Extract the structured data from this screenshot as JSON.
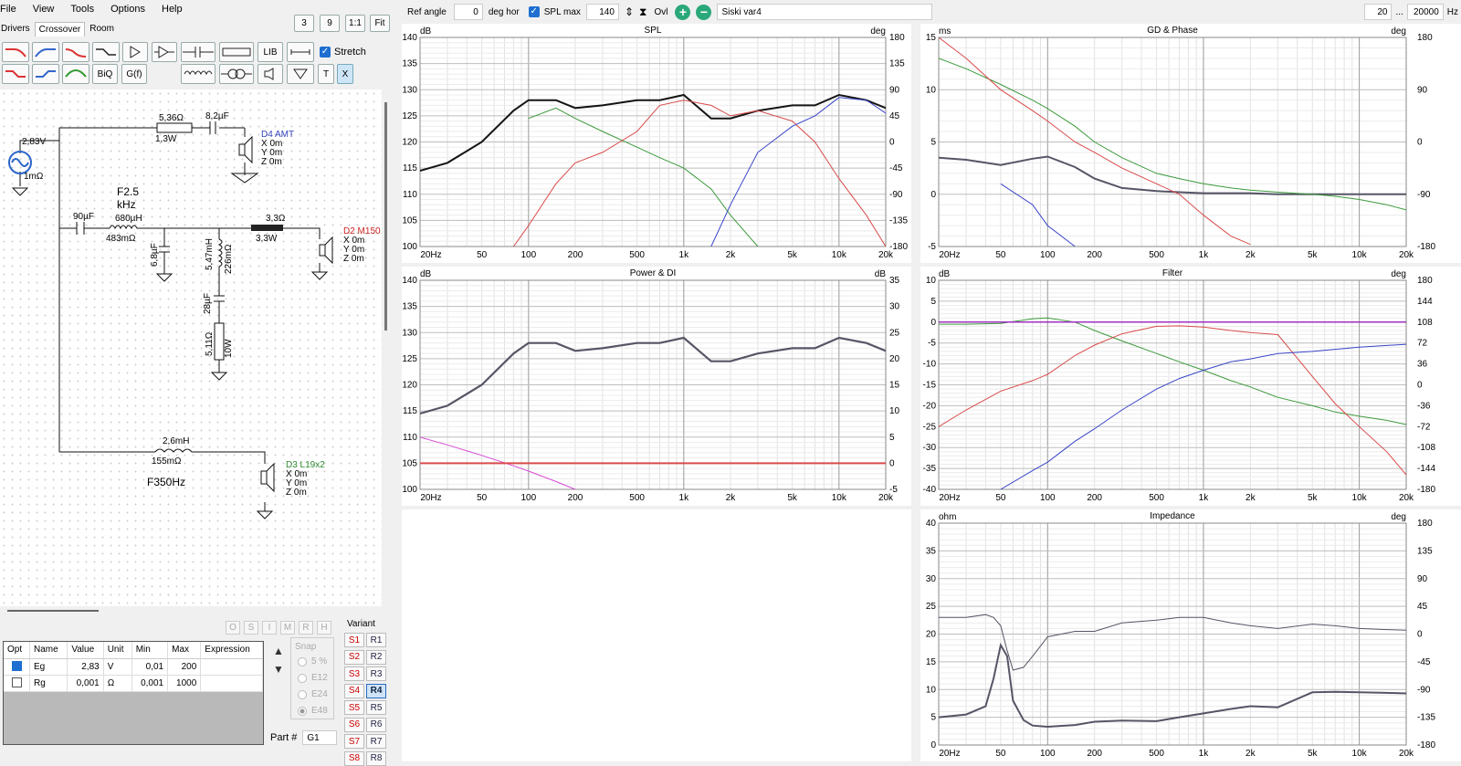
{
  "menu": [
    "File",
    "View",
    "Tools",
    "Options",
    "Help"
  ],
  "tabs": [
    "Drivers",
    "Crossover",
    "Room"
  ],
  "zoom_buttons": [
    "3",
    "9",
    "1:1",
    "Fit"
  ],
  "toolbar": {
    "lib": "LIB",
    "stretch": "Stretch",
    "biq": "BiQ",
    "gf": "G(f)",
    "t": "T",
    "x": "X"
  },
  "top": {
    "ref_angle_label": "Ref angle",
    "ref_angle_value": "0",
    "deg_hor": "deg hor",
    "spl_max_label": "SPL max",
    "spl_max_value": "140",
    "ovl": "Ovl",
    "project_name": "Siski var4",
    "f_min": "20",
    "dots": "...",
    "f_max": "20000",
    "hz": "Hz"
  },
  "schematic": {
    "source_voltage": "2,83V",
    "source_r": "1mΩ",
    "r1": "5,36Ω",
    "r1w": "1,3W",
    "c1": "8,2µF",
    "d4": {
      "name": "D4 AMT",
      "x": "X 0m",
      "y": "Y 0m",
      "z": "Z 0m"
    },
    "f25a": "F2.5",
    "f25b": "kHz",
    "c2": "90µF",
    "l1": "680µH",
    "l1r": "483mΩ",
    "r2": "3,3Ω",
    "r2w": "3,3W",
    "c3": "6,8µF",
    "l2": "5,47mH",
    "l2r": "226mΩ",
    "c4": "28µF",
    "r3": "5,11Ω",
    "r3w": "10W",
    "d2": {
      "name": "D2 M150",
      "x": "X 0m",
      "y": "Y 0m",
      "z": "Z 0m"
    },
    "l3": "2,6mH",
    "l3r": "155mΩ",
    "f350": "F350Hz",
    "d3": {
      "name": "D3 L19x2",
      "x": "X 0m",
      "y": "Y 0m",
      "z": "Z 0m"
    }
  },
  "chips": [
    "O",
    "S",
    "I",
    "M",
    "R",
    "H"
  ],
  "params": {
    "headers": [
      "Opt",
      "Name",
      "Value",
      "Unit",
      "Min",
      "Max",
      "Expression"
    ],
    "rows": [
      {
        "opt": true,
        "name": "Eg",
        "value": "2,83",
        "unit": "V",
        "min": "0,01",
        "max": "200",
        "expr": ""
      },
      {
        "opt": false,
        "name": "Rg",
        "value": "0,001",
        "unit": "Ω",
        "min": "0,001",
        "max": "1000",
        "expr": ""
      }
    ]
  },
  "snap": {
    "label": "Snap",
    "options": [
      "5 %",
      "E12",
      "E24",
      "E48"
    ],
    "selected": "E48"
  },
  "variant": {
    "label": "Variant",
    "s": [
      "S1",
      "S2",
      "S3",
      "S4",
      "S5",
      "S6",
      "S7",
      "S8"
    ],
    "r": [
      "R1",
      "R2",
      "R3",
      "R4",
      "R5",
      "R6",
      "R7",
      "R8"
    ],
    "selected": "R4"
  },
  "part": {
    "label": "Part #",
    "value": "G1"
  },
  "colors": {
    "black": "#141414",
    "green": "#3d9a3d",
    "red": "#d94a4a",
    "blue": "#3845c8",
    "gray": "#555566",
    "magenta": "#d84ad8",
    "purple": "#a030c0"
  },
  "xticks": [
    "20Hz",
    "50",
    "100",
    "200",
    "500",
    "1k",
    "2k",
    "5k",
    "10k",
    "20k"
  ],
  "chart_data": [
    {
      "type": "line",
      "title": "SPL",
      "ylabel_left": "dB",
      "ylabel_right": "deg",
      "ylim": [
        100,
        140
      ],
      "ylim_right": [
        -180,
        180
      ],
      "yticks": [
        "140",
        "135",
        "130",
        "125",
        "120",
        "115",
        "110",
        "105",
        "100"
      ],
      "yticks_right": [
        "180",
        "135",
        "90",
        "45",
        "0",
        "-45",
        "-90",
        "-135",
        "-180"
      ],
      "x": [
        20,
        30,
        50,
        80,
        100,
        150,
        200,
        300,
        500,
        700,
        1000,
        1500,
        2000,
        3000,
        5000,
        7000,
        10000,
        15000,
        20000
      ],
      "series": [
        {
          "values": [
            114.5,
            116,
            120,
            126,
            128,
            128,
            126.5,
            127,
            128,
            128,
            129,
            124.5,
            124.5,
            126,
            127,
            127,
            129,
            128,
            126.5
          ]
        },
        {
          "values": [
            null,
            null,
            null,
            null,
            124.5,
            126.5,
            124.5,
            122,
            119,
            117,
            115,
            111,
            106,
            100,
            null,
            null,
            null,
            null,
            null
          ]
        },
        {
          "values": [
            null,
            null,
            null,
            100,
            104,
            112,
            116,
            118,
            122,
            127,
            128,
            127,
            125,
            126,
            124,
            120,
            113,
            106,
            100
          ]
        },
        {
          "values": [
            null,
            null,
            null,
            null,
            null,
            null,
            null,
            null,
            null,
            null,
            null,
            100,
            108,
            118,
            123,
            125,
            128.5,
            128,
            125.5
          ]
        }
      ]
    },
    {
      "type": "line",
      "title": "GD & Phase",
      "ylabel_left": "ms",
      "ylabel_right": "deg",
      "ylim": [
        -5,
        15
      ],
      "ylim_right": [
        -180,
        180
      ],
      "yticks": [
        "15",
        "10",
        "5",
        "0",
        "-5"
      ],
      "yticks_right": [
        "180",
        "90",
        "0",
        "-90",
        "-180"
      ],
      "x": [
        20,
        30,
        50,
        80,
        100,
        150,
        200,
        300,
        500,
        700,
        1000,
        1500,
        2000,
        3000,
        5000,
        7000,
        10000,
        15000,
        20000
      ],
      "series": [
        {
          "values": [
            3.5,
            3.3,
            2.8,
            3.4,
            3.6,
            2.6,
            1.5,
            0.6,
            0.3,
            0.2,
            0.1,
            0.1,
            0.1,
            0.0,
            0.0,
            0.0,
            0.0,
            0.0,
            0.0
          ]
        },
        {
          "values": [
            13,
            12,
            10.5,
            9,
            8.2,
            6.5,
            5,
            3.5,
            2,
            1.5,
            1,
            0.6,
            0.4,
            0.2,
            0,
            -0.2,
            -0.5,
            -1,
            -1.5
          ]
        },
        {
          "values": [
            15,
            13,
            10,
            8,
            7,
            5,
            4,
            2.5,
            1,
            0,
            -2,
            -4,
            -4.8,
            null,
            null,
            null,
            null,
            null,
            null
          ]
        },
        {
          "values": [
            null,
            null,
            1,
            -1,
            -3,
            -5,
            null,
            null,
            null,
            null,
            null,
            null,
            null,
            null,
            null,
            null,
            null,
            null,
            null
          ]
        }
      ]
    },
    {
      "type": "line",
      "title": "Power & DI",
      "ylabel_left": "dB",
      "ylabel_right": "dB",
      "ylim": [
        100,
        140
      ],
      "ylim_right": [
        -5,
        35
      ],
      "yticks": [
        "140",
        "135",
        "130",
        "125",
        "120",
        "115",
        "110",
        "105",
        "100"
      ],
      "yticks_right": [
        "35",
        "30",
        "25",
        "20",
        "15",
        "10",
        "5",
        "0",
        "-5"
      ],
      "x": [
        20,
        30,
        50,
        80,
        100,
        150,
        200,
        300,
        500,
        700,
        1000,
        1500,
        2000,
        3000,
        5000,
        7000,
        10000,
        15000,
        20000
      ],
      "series": [
        {
          "values": [
            114.5,
            116,
            120,
            126,
            128,
            128,
            126.5,
            127,
            128,
            128,
            129,
            124.5,
            124.5,
            126,
            127,
            127,
            129,
            128,
            126.5
          ]
        },
        {
          "values": [
            110,
            108.5,
            106.5,
            104.5,
            103.5,
            101.5,
            100,
            null,
            null,
            null,
            null,
            null,
            null,
            null,
            null,
            null,
            null,
            null,
            null
          ]
        },
        {
          "values": [
            105,
            105,
            105,
            105,
            105,
            105,
            105,
            105,
            105,
            105,
            105,
            105,
            105,
            105,
            105,
            105,
            105,
            105,
            105
          ]
        }
      ]
    },
    {
      "type": "line",
      "title": "Filter",
      "ylabel_left": "dB",
      "ylabel_right": "deg",
      "ylim": [
        -40,
        10
      ],
      "ylim_right": [
        -180,
        180
      ],
      "yticks": [
        "10",
        "5",
        "0",
        "-5",
        "-10",
        "-15",
        "-20",
        "-25",
        "-30",
        "-35",
        "-40"
      ],
      "yticks_right": [
        "180",
        "144",
        "108",
        "72",
        "36",
        "0",
        "-36",
        "-72",
        "-108",
        "-144",
        "-180"
      ],
      "x": [
        20,
        30,
        50,
        80,
        100,
        150,
        200,
        300,
        500,
        700,
        1000,
        1500,
        2000,
        3000,
        5000,
        7000,
        10000,
        15000,
        20000
      ],
      "series": [
        {
          "values": [
            -0.5,
            -0.5,
            -0.3,
            0.8,
            1,
            0,
            -2,
            -4.5,
            -7.5,
            -9.5,
            -11.5,
            -14,
            -15.5,
            -18,
            -20,
            -21.5,
            -22.5,
            -23.5,
            -24.5
          ]
        },
        {
          "values": [
            -25,
            -21,
            -16.5,
            -14,
            -12.5,
            -8,
            -5.5,
            -2.8,
            -1,
            -0.9,
            -1.2,
            -2,
            -2.5,
            -3,
            -13,
            -19.5,
            -25,
            -31,
            -36.5
          ]
        },
        {
          "values": [
            null,
            null,
            -40,
            -35.5,
            -33.5,
            -28.5,
            -25.5,
            -21,
            -16,
            -13.5,
            -11.5,
            -9.5,
            -8.8,
            -7.5,
            -7,
            -6.5,
            -6,
            -5.6,
            -5.3
          ]
        },
        {
          "values": [
            0,
            0,
            0,
            0,
            0,
            0,
            0,
            0,
            0,
            0,
            0,
            0,
            0,
            0,
            0,
            0,
            0,
            0,
            0
          ]
        }
      ]
    },
    {
      "type": "line",
      "title": "Impedance",
      "ylabel_left": "ohm",
      "ylabel_right": "deg",
      "ylim": [
        0,
        40
      ],
      "ylim_right": [
        -180,
        180
      ],
      "yticks": [
        "40",
        "35",
        "30",
        "25",
        "20",
        "15",
        "10",
        "5",
        "0"
      ],
      "yticks_right": [
        "180",
        "135",
        "90",
        "45",
        "0",
        "-45",
        "-90",
        "-135",
        "-180"
      ],
      "x": [
        20,
        30,
        40,
        45,
        50,
        55,
        60,
        70,
        80,
        100,
        150,
        200,
        300,
        500,
        700,
        1000,
        1500,
        2000,
        3000,
        5000,
        7000,
        10000,
        15000,
        20000
      ],
      "series": [
        {
          "values": [
            5,
            5.5,
            7,
            12,
            18,
            16,
            8,
            4.5,
            3.5,
            3.3,
            3.6,
            4.2,
            4.4,
            4.3,
            5,
            5.7,
            6.5,
            7,
            6.8,
            9.5,
            9.6,
            9.5,
            9.4,
            9.3
          ]
        },
        {
          "values": [
            23,
            23,
            23.5,
            23,
            21.5,
            17,
            13.5,
            14,
            16,
            19.5,
            20.5,
            20.5,
            22,
            22.5,
            23,
            23,
            22,
            21.5,
            21,
            21.8,
            21.5,
            21,
            20.8,
            20.7
          ]
        }
      ]
    }
  ]
}
